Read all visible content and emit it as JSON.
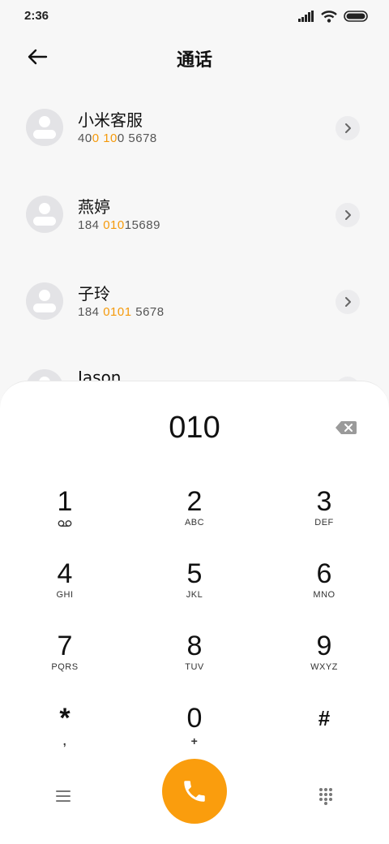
{
  "status_bar": {
    "time": "2:36"
  },
  "header": {
    "title": "通话"
  },
  "contacts": [
    {
      "name": "小米客服",
      "number": [
        {
          "t": "40",
          "hl": false
        },
        {
          "t": "0",
          "hl": true
        },
        {
          "t": " ",
          "hl": false
        },
        {
          "t": "10",
          "hl": true
        },
        {
          "t": "0 5678",
          "hl": false
        }
      ]
    },
    {
      "name": "燕婷",
      "number": [
        {
          "t": "184 ",
          "hl": false
        },
        {
          "t": "010",
          "hl": true
        },
        {
          "t": "15689",
          "hl": false
        }
      ]
    },
    {
      "name": "子玲",
      "number": [
        {
          "t": "184 ",
          "hl": false
        },
        {
          "t": "0101",
          "hl": true
        },
        {
          "t": " 5678",
          "hl": false
        }
      ]
    },
    {
      "name": "Jason",
      "number": []
    }
  ],
  "dialer": {
    "dialed": "010",
    "keys": [
      {
        "digit": "1",
        "letters": ""
      },
      {
        "digit": "2",
        "letters": "ABC"
      },
      {
        "digit": "3",
        "letters": "DEF"
      },
      {
        "digit": "4",
        "letters": "GHI"
      },
      {
        "digit": "5",
        "letters": "JKL"
      },
      {
        "digit": "6",
        "letters": "MNO"
      },
      {
        "digit": "7",
        "letters": "PQRS"
      },
      {
        "digit": "8",
        "letters": "TUV"
      },
      {
        "digit": "9",
        "letters": "WXYZ"
      },
      {
        "digit": "*",
        "letters": ","
      },
      {
        "digit": "0",
        "letters": "+"
      },
      {
        "digit": "#",
        "letters": ""
      }
    ]
  },
  "colors": {
    "accent": "#fa9d0d",
    "highlight": "#f59a0b"
  },
  "icons": {
    "back": "arrow-left-icon",
    "detail": "chevron-right-icon",
    "backspace": "backspace-icon",
    "voicemail": "voicemail-icon",
    "menu": "menu-icon",
    "call": "phone-icon",
    "keypad": "dialpad-icon"
  }
}
